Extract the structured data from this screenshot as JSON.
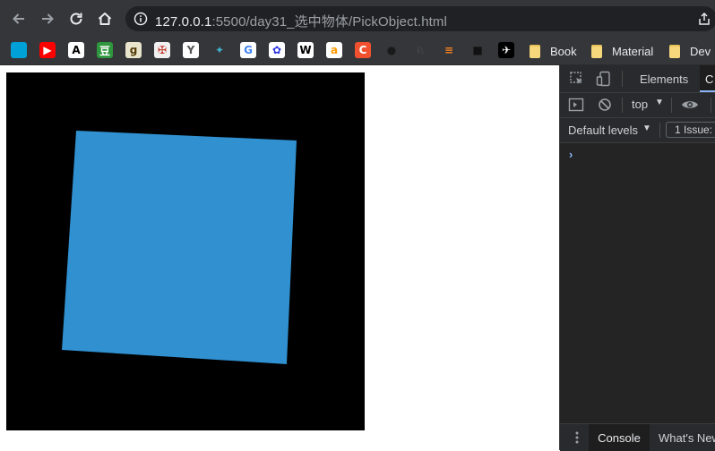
{
  "address_bar": {
    "url_host": "127.0.0.1",
    "url_rest": ":5500/day31_选中物体/PickObject.html"
  },
  "bookmarks": {
    "icons": [
      {
        "name": "bilibili-icon",
        "glyph": "",
        "bg": "#00a1d6"
      },
      {
        "name": "youtube-icon",
        "glyph": "▶",
        "bg": "#ff0000"
      },
      {
        "name": "a-bookmark-icon",
        "glyph": "A",
        "bg": "#ffffff",
        "fg": "#000000"
      },
      {
        "name": "douban-icon",
        "glyph": "豆",
        "bg": "#2e963d"
      },
      {
        "name": "goodreads-icon",
        "glyph": "g",
        "bg": "#e9e5cd",
        "fg": "#553b08"
      },
      {
        "name": "pirate-icon",
        "glyph": "✠",
        "bg": "#f0f0f0",
        "fg": "#c0392b"
      },
      {
        "name": "y-bookmark-icon",
        "glyph": "Y",
        "bg": "#ffffff",
        "fg": "#555555"
      },
      {
        "name": "bird-icon",
        "glyph": "✦",
        "bg": "#353639",
        "fg": "#3fb0c8"
      },
      {
        "name": "google-icon",
        "glyph": "G",
        "bg": "#ffffff",
        "fg": "#4285f4"
      },
      {
        "name": "baidu-icon",
        "glyph": "✿",
        "bg": "#ffffff",
        "fg": "#2932e1"
      },
      {
        "name": "wikipedia-icon",
        "glyph": "W",
        "bg": "#ffffff",
        "fg": "#000000"
      },
      {
        "name": "amazon-icon",
        "glyph": "a",
        "bg": "#ffffff",
        "fg": "#ff9900"
      },
      {
        "name": "c-bookmark-icon",
        "glyph": "C",
        "bg": "#f1502f"
      },
      {
        "name": "github-icon",
        "glyph": "●",
        "bg": "#353639",
        "fg": "#1a1a1a"
      },
      {
        "name": "shrug-icon",
        "glyph": "♘",
        "bg": "#353639",
        "fg": "#666666"
      },
      {
        "name": "stackoverflow-icon",
        "glyph": "≡",
        "bg": "#353639",
        "fg": "#f48024"
      },
      {
        "name": "dark-square-icon",
        "glyph": "■",
        "bg": "#353639",
        "fg": "#111111"
      },
      {
        "name": "rocket-icon",
        "glyph": "✈",
        "bg": "#000000",
        "fg": "#ffffff"
      }
    ],
    "folders": [
      "Book",
      "Material",
      "Dev"
    ]
  },
  "canvas": {
    "background": "#000000",
    "shape_color": "#3090d0"
  },
  "devtools": {
    "tab_elements": "Elements",
    "tab_console_cut": "C",
    "context": "top",
    "levels": "Default levels",
    "issues": "1 Issue:",
    "prompt": "›",
    "drawer_console": "Console",
    "drawer_whatsnew": "What's New"
  }
}
